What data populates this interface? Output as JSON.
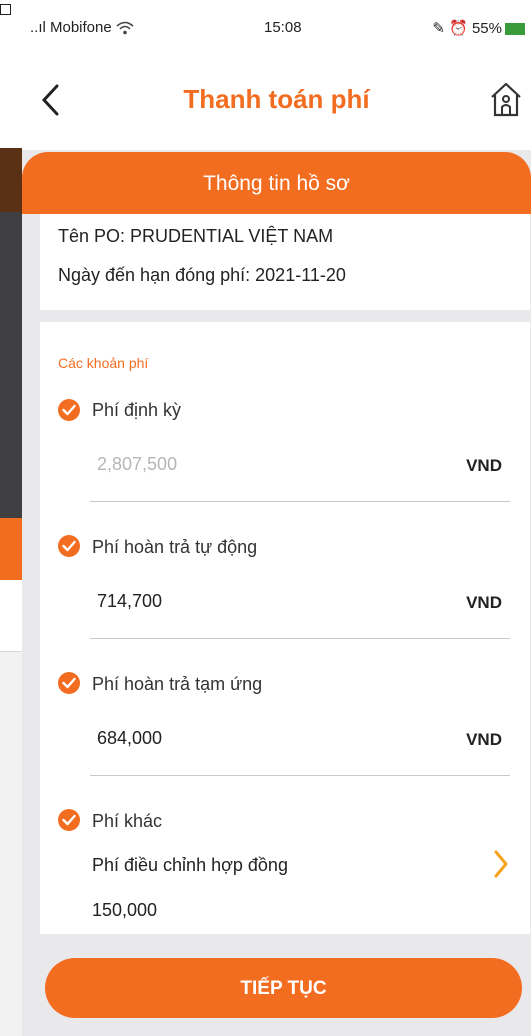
{
  "status_bar": {
    "carrier": "..ıl Mobifone",
    "time": "15:08",
    "battery": "55%"
  },
  "header": {
    "title": "Thanh toán phí"
  },
  "section": {
    "title": "Thông tin hồ sơ"
  },
  "info": {
    "po_name": "Tên PO: PRUDENTIAL VIỆT NAM",
    "due_date": "Ngày đến hạn đóng phí: 2021-11-20"
  },
  "fees": {
    "label": "Các khoản phí",
    "items": [
      {
        "name": "Phí định kỳ",
        "value": "2,807,500",
        "currency": "VND"
      },
      {
        "name": "Phí hoàn trả tự động",
        "value": "714,700",
        "currency": "VND"
      },
      {
        "name": "Phí hoàn trả tạm ứng",
        "value": "684,000",
        "currency": "VND"
      }
    ],
    "other": {
      "name": "Phí khác",
      "sub": "Phí điều chỉnh hợp đồng",
      "value": "150,000"
    }
  },
  "actions": {
    "continue_label": "TIẾP TỤC"
  },
  "colors": {
    "accent": "#f36d21"
  }
}
